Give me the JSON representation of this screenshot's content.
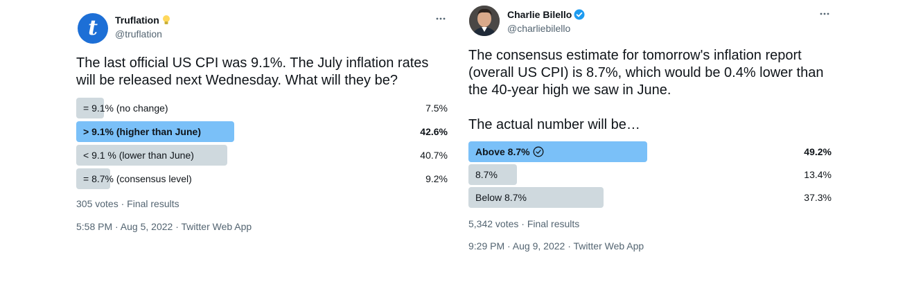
{
  "tweets": [
    {
      "author": {
        "name": "Truflation",
        "handle": "@truflation",
        "badge_icon": "lightbulb-icon"
      },
      "text": "The last official US CPI was 9.1%. The July inflation rates will be released next Wednesday. What will they be?",
      "poll": {
        "options": [
          {
            "label": "= 9.1% (no change)",
            "percent_text": "7.5%",
            "percent": 7.5,
            "winner": false
          },
          {
            "label": "> 9.1% (higher than June)",
            "percent_text": "42.6%",
            "percent": 42.6,
            "winner": true
          },
          {
            "label": "< 9.1 % (lower than June)",
            "percent_text": "40.7%",
            "percent": 40.7,
            "winner": false
          },
          {
            "label": "= 8.7% (consensus level)",
            "percent_text": "9.2%",
            "percent": 9.2,
            "winner": false
          }
        ],
        "meta": "305 votes · Final results"
      },
      "timestamp": "5:58 PM · Aug 5, 2022 · Twitter Web App"
    },
    {
      "author": {
        "name": "Charlie Bilello",
        "handle": "@charliebilello",
        "badge_icon": "verified-badge-icon"
      },
      "text": "The consensus estimate for tomorrow's inflation report (overall US CPI) is 8.7%, which would be 0.4% lower than the 40-year high we saw in June.\n\nThe actual number will be…",
      "poll": {
        "options": [
          {
            "label": "Above 8.7%",
            "percent_text": "49.2%",
            "percent": 49.2,
            "winner": true
          },
          {
            "label": "8.7%",
            "percent_text": "13.4%",
            "percent": 13.4,
            "winner": false
          },
          {
            "label": "Below 8.7%",
            "percent_text": "37.3%",
            "percent": 37.3,
            "winner": false
          }
        ],
        "meta": "5,342 votes · Final results"
      },
      "timestamp": "9:29 PM · Aug 9, 2022 · Twitter Web App"
    }
  ],
  "colors": {
    "winner_bar": "#7ac0f8",
    "bar": "#cfd9de",
    "secondary_text": "#536471",
    "verified": "#1d9bf0",
    "truflation_brand": "#1d6fd6"
  },
  "icons": {
    "more": "more-options-icon",
    "winner_check": "check-circle-icon"
  }
}
